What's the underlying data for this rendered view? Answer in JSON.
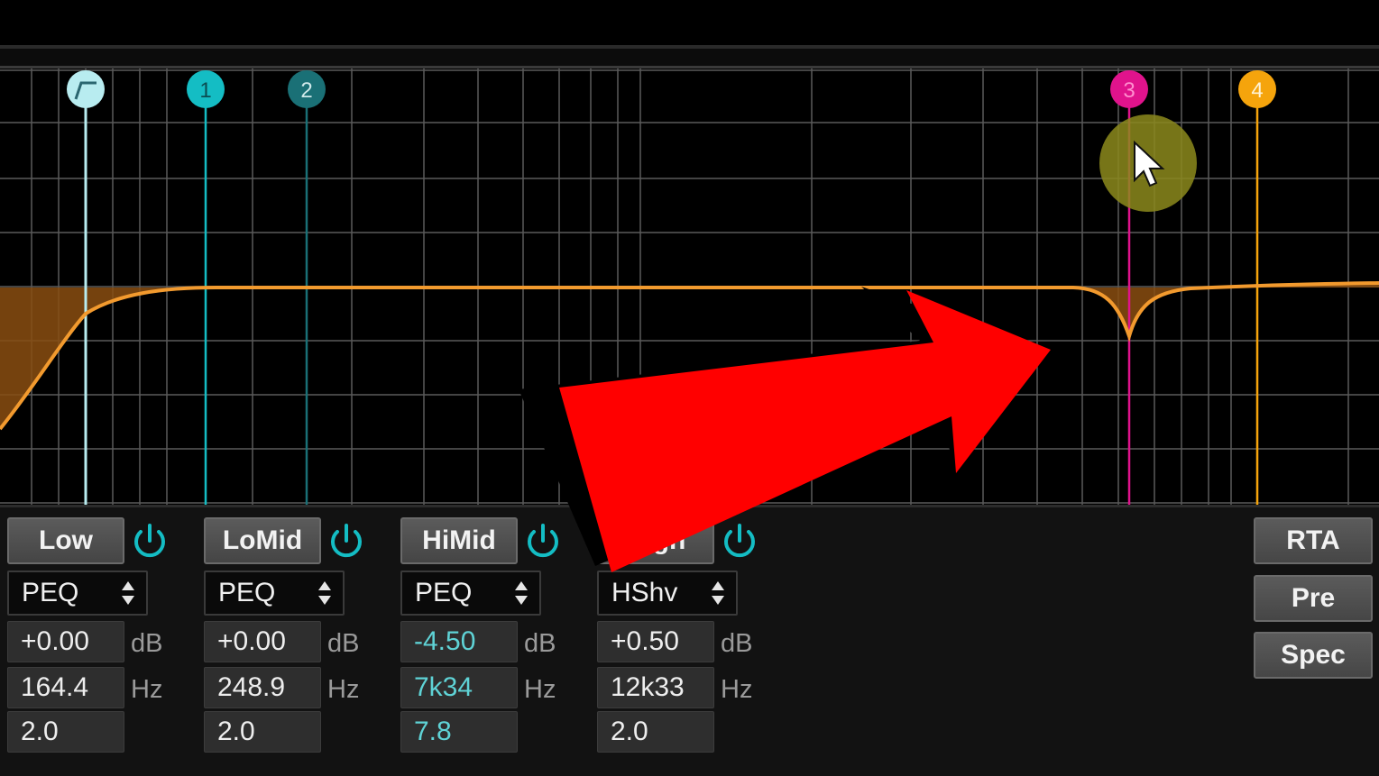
{
  "bands": [
    {
      "name": "Low",
      "type": "PEQ",
      "gain": "+0.00",
      "freq": "164.4",
      "q": "2.0",
      "accent": false
    },
    {
      "name": "LoMid",
      "type": "PEQ",
      "gain": "+0.00",
      "freq": "248.9",
      "q": "2.0",
      "accent": false
    },
    {
      "name": "HiMid",
      "type": "PEQ",
      "gain": "-4.50",
      "freq": "7k34",
      "q": "7.8",
      "accent": true
    },
    {
      "name": "High",
      "type": "HShv",
      "gain": "+0.50",
      "freq": "12k33",
      "q": "2.0",
      "accent": false
    }
  ],
  "units": {
    "gain": "dB",
    "freq": "Hz"
  },
  "side_buttons": [
    "RTA",
    "Pre",
    "Spec"
  ],
  "nodes": [
    {
      "label": "",
      "color": "#b8ecf0",
      "kind": "hp-filter-icon"
    },
    {
      "label": "1",
      "color": "#14bdc4"
    },
    {
      "label": "2",
      "color": "#1a7076"
    },
    {
      "label": "3",
      "color": "#e0138c"
    },
    {
      "label": "4",
      "color": "#f5a40c"
    }
  ],
  "colors": {
    "curve": "#f29a2e",
    "curve_fill": "#8a4d10",
    "grid": "#5a5a5a",
    "accent_text": "#5fd3d6",
    "annotation_arrow": "#ff0000",
    "cursor_highlight": "#8c8a1c"
  }
}
